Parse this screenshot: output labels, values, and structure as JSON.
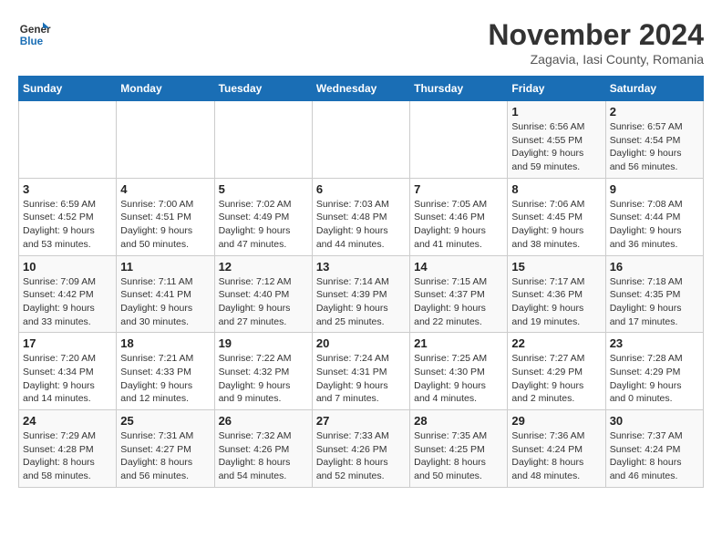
{
  "logo": {
    "line1": "General",
    "line2": "Blue"
  },
  "title": "November 2024",
  "subtitle": "Zagavia, Iasi County, Romania",
  "days_of_week": [
    "Sunday",
    "Monday",
    "Tuesday",
    "Wednesday",
    "Thursday",
    "Friday",
    "Saturday"
  ],
  "weeks": [
    [
      {
        "day": "",
        "details": ""
      },
      {
        "day": "",
        "details": ""
      },
      {
        "day": "",
        "details": ""
      },
      {
        "day": "",
        "details": ""
      },
      {
        "day": "",
        "details": ""
      },
      {
        "day": "1",
        "details": "Sunrise: 6:56 AM\nSunset: 4:55 PM\nDaylight: 9 hours and 59 minutes."
      },
      {
        "day": "2",
        "details": "Sunrise: 6:57 AM\nSunset: 4:54 PM\nDaylight: 9 hours and 56 minutes."
      }
    ],
    [
      {
        "day": "3",
        "details": "Sunrise: 6:59 AM\nSunset: 4:52 PM\nDaylight: 9 hours and 53 minutes."
      },
      {
        "day": "4",
        "details": "Sunrise: 7:00 AM\nSunset: 4:51 PM\nDaylight: 9 hours and 50 minutes."
      },
      {
        "day": "5",
        "details": "Sunrise: 7:02 AM\nSunset: 4:49 PM\nDaylight: 9 hours and 47 minutes."
      },
      {
        "day": "6",
        "details": "Sunrise: 7:03 AM\nSunset: 4:48 PM\nDaylight: 9 hours and 44 minutes."
      },
      {
        "day": "7",
        "details": "Sunrise: 7:05 AM\nSunset: 4:46 PM\nDaylight: 9 hours and 41 minutes."
      },
      {
        "day": "8",
        "details": "Sunrise: 7:06 AM\nSunset: 4:45 PM\nDaylight: 9 hours and 38 minutes."
      },
      {
        "day": "9",
        "details": "Sunrise: 7:08 AM\nSunset: 4:44 PM\nDaylight: 9 hours and 36 minutes."
      }
    ],
    [
      {
        "day": "10",
        "details": "Sunrise: 7:09 AM\nSunset: 4:42 PM\nDaylight: 9 hours and 33 minutes."
      },
      {
        "day": "11",
        "details": "Sunrise: 7:11 AM\nSunset: 4:41 PM\nDaylight: 9 hours and 30 minutes."
      },
      {
        "day": "12",
        "details": "Sunrise: 7:12 AM\nSunset: 4:40 PM\nDaylight: 9 hours and 27 minutes."
      },
      {
        "day": "13",
        "details": "Sunrise: 7:14 AM\nSunset: 4:39 PM\nDaylight: 9 hours and 25 minutes."
      },
      {
        "day": "14",
        "details": "Sunrise: 7:15 AM\nSunset: 4:37 PM\nDaylight: 9 hours and 22 minutes."
      },
      {
        "day": "15",
        "details": "Sunrise: 7:17 AM\nSunset: 4:36 PM\nDaylight: 9 hours and 19 minutes."
      },
      {
        "day": "16",
        "details": "Sunrise: 7:18 AM\nSunset: 4:35 PM\nDaylight: 9 hours and 17 minutes."
      }
    ],
    [
      {
        "day": "17",
        "details": "Sunrise: 7:20 AM\nSunset: 4:34 PM\nDaylight: 9 hours and 14 minutes."
      },
      {
        "day": "18",
        "details": "Sunrise: 7:21 AM\nSunset: 4:33 PM\nDaylight: 9 hours and 12 minutes."
      },
      {
        "day": "19",
        "details": "Sunrise: 7:22 AM\nSunset: 4:32 PM\nDaylight: 9 hours and 9 minutes."
      },
      {
        "day": "20",
        "details": "Sunrise: 7:24 AM\nSunset: 4:31 PM\nDaylight: 9 hours and 7 minutes."
      },
      {
        "day": "21",
        "details": "Sunrise: 7:25 AM\nSunset: 4:30 PM\nDaylight: 9 hours and 4 minutes."
      },
      {
        "day": "22",
        "details": "Sunrise: 7:27 AM\nSunset: 4:29 PM\nDaylight: 9 hours and 2 minutes."
      },
      {
        "day": "23",
        "details": "Sunrise: 7:28 AM\nSunset: 4:29 PM\nDaylight: 9 hours and 0 minutes."
      }
    ],
    [
      {
        "day": "24",
        "details": "Sunrise: 7:29 AM\nSunset: 4:28 PM\nDaylight: 8 hours and 58 minutes."
      },
      {
        "day": "25",
        "details": "Sunrise: 7:31 AM\nSunset: 4:27 PM\nDaylight: 8 hours and 56 minutes."
      },
      {
        "day": "26",
        "details": "Sunrise: 7:32 AM\nSunset: 4:26 PM\nDaylight: 8 hours and 54 minutes."
      },
      {
        "day": "27",
        "details": "Sunrise: 7:33 AM\nSunset: 4:26 PM\nDaylight: 8 hours and 52 minutes."
      },
      {
        "day": "28",
        "details": "Sunrise: 7:35 AM\nSunset: 4:25 PM\nDaylight: 8 hours and 50 minutes."
      },
      {
        "day": "29",
        "details": "Sunrise: 7:36 AM\nSunset: 4:24 PM\nDaylight: 8 hours and 48 minutes."
      },
      {
        "day": "30",
        "details": "Sunrise: 7:37 AM\nSunset: 4:24 PM\nDaylight: 8 hours and 46 minutes."
      }
    ]
  ]
}
